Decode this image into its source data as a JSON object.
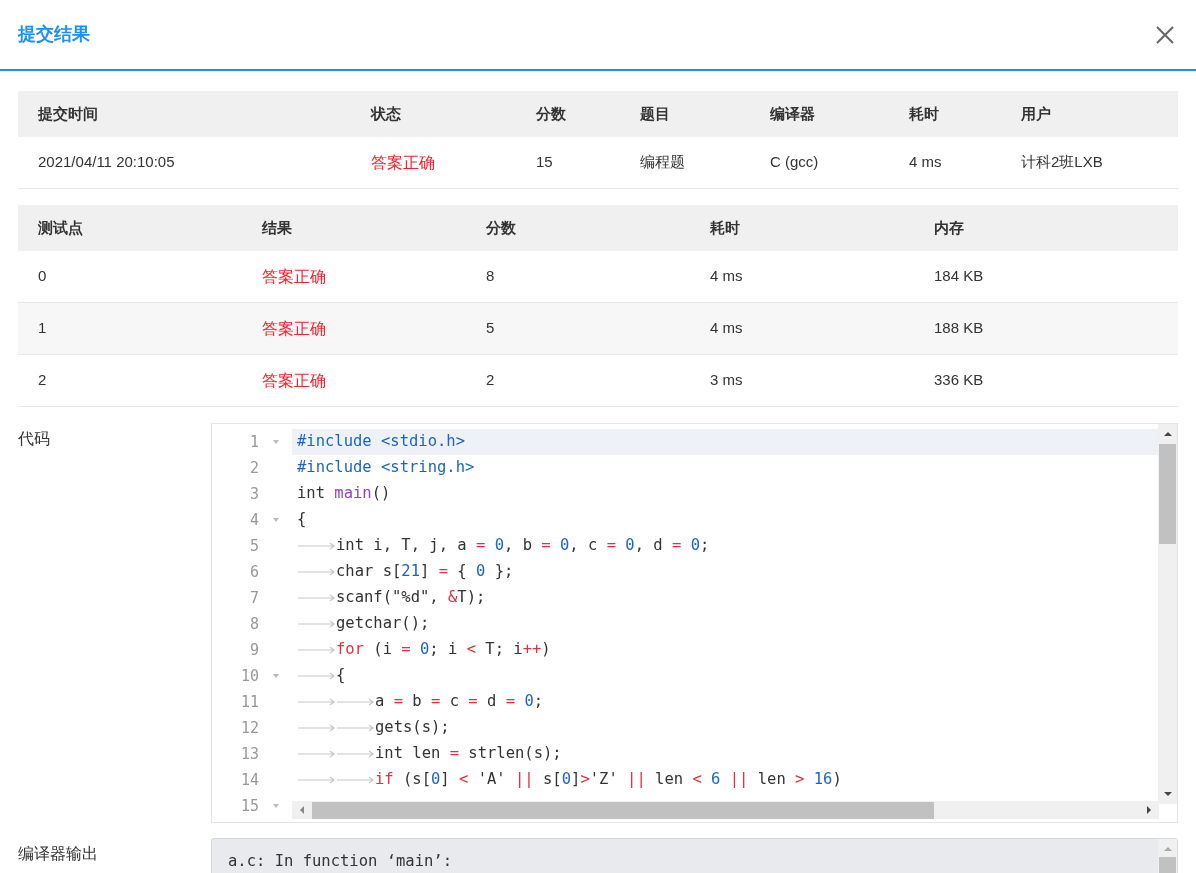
{
  "dialog": {
    "title": "提交结果"
  },
  "submission": {
    "columns": [
      "提交时间",
      "状态",
      "分数",
      "题目",
      "编译器",
      "耗时",
      "用户"
    ],
    "row": [
      "2021/04/11 20:10:05",
      "答案正确",
      "15",
      "编程题",
      "C (gcc)",
      "4 ms",
      "计科2班LXB"
    ]
  },
  "tests": {
    "columns": [
      "测试点",
      "结果",
      "分数",
      "耗时",
      "内存"
    ],
    "rows": [
      [
        "0",
        "答案正确",
        "8",
        "4 ms",
        "184 KB"
      ],
      [
        "1",
        "答案正确",
        "5",
        "4 ms",
        "188 KB"
      ],
      [
        "2",
        "答案正确",
        "2",
        "3 ms",
        "336 KB"
      ]
    ]
  },
  "code": {
    "label": "代码",
    "lines": [
      {
        "number": "1",
        "fold": true,
        "active": true,
        "tokens": [
          {
            "kind": "pre",
            "text": "#include <stdio.h>"
          }
        ]
      },
      {
        "number": "2",
        "fold": false,
        "active": false,
        "tokens": [
          {
            "kind": "pre",
            "text": "#include <string.h>"
          }
        ]
      },
      {
        "number": "3",
        "fold": false,
        "active": false,
        "tokens": [
          {
            "kind": "plain",
            "text": "int "
          },
          {
            "kind": "fn",
            "text": "main"
          },
          {
            "kind": "plain",
            "text": "()"
          }
        ]
      },
      {
        "number": "4",
        "fold": true,
        "active": false,
        "tokens": [
          {
            "kind": "plain",
            "text": "{"
          }
        ]
      },
      {
        "number": "5",
        "fold": false,
        "active": false,
        "tokens": [
          {
            "kind": "tab"
          },
          {
            "kind": "plain",
            "text": "int i, T, j, a"
          },
          {
            "kind": "op",
            "text": " = "
          },
          {
            "kind": "num",
            "text": "0"
          },
          {
            "kind": "plain",
            "text": ", b"
          },
          {
            "kind": "op",
            "text": " = "
          },
          {
            "kind": "num",
            "text": "0"
          },
          {
            "kind": "plain",
            "text": ", c"
          },
          {
            "kind": "op",
            "text": " = "
          },
          {
            "kind": "num",
            "text": "0"
          },
          {
            "kind": "plain",
            "text": ", d"
          },
          {
            "kind": "op",
            "text": " = "
          },
          {
            "kind": "num",
            "text": "0"
          },
          {
            "kind": "plain",
            "text": ";"
          }
        ]
      },
      {
        "number": "6",
        "fold": false,
        "active": false,
        "tokens": [
          {
            "kind": "tab"
          },
          {
            "kind": "plain",
            "text": "char s["
          },
          {
            "kind": "num",
            "text": "21"
          },
          {
            "kind": "plain",
            "text": "] "
          },
          {
            "kind": "op",
            "text": "="
          },
          {
            "kind": "plain",
            "text": " { "
          },
          {
            "kind": "num",
            "text": "0"
          },
          {
            "kind": "plain",
            "text": " };"
          }
        ]
      },
      {
        "number": "7",
        "fold": false,
        "active": false,
        "tokens": [
          {
            "kind": "tab"
          },
          {
            "kind": "plain",
            "text": "scanf(\"%d\", "
          },
          {
            "kind": "op",
            "text": "&"
          },
          {
            "kind": "plain",
            "text": "T);"
          }
        ]
      },
      {
        "number": "8",
        "fold": false,
        "active": false,
        "tokens": [
          {
            "kind": "tab"
          },
          {
            "kind": "plain",
            "text": "getchar();"
          }
        ]
      },
      {
        "number": "9",
        "fold": false,
        "active": false,
        "tokens": [
          {
            "kind": "tab"
          },
          {
            "kind": "kw",
            "text": "for"
          },
          {
            "kind": "plain",
            "text": " (i"
          },
          {
            "kind": "op",
            "text": " = "
          },
          {
            "kind": "num",
            "text": "0"
          },
          {
            "kind": "plain",
            "text": "; i "
          },
          {
            "kind": "op",
            "text": "<"
          },
          {
            "kind": "plain",
            "text": " T; i"
          },
          {
            "kind": "op",
            "text": "++"
          },
          {
            "kind": "plain",
            "text": ")"
          }
        ]
      },
      {
        "number": "10",
        "fold": true,
        "active": false,
        "tokens": [
          {
            "kind": "tab"
          },
          {
            "kind": "plain",
            "text": "{"
          }
        ]
      },
      {
        "number": "11",
        "fold": false,
        "active": false,
        "tokens": [
          {
            "kind": "tab"
          },
          {
            "kind": "tab"
          },
          {
            "kind": "plain",
            "text": "a "
          },
          {
            "kind": "op",
            "text": "="
          },
          {
            "kind": "plain",
            "text": " b "
          },
          {
            "kind": "op",
            "text": "="
          },
          {
            "kind": "plain",
            "text": " c "
          },
          {
            "kind": "op",
            "text": "="
          },
          {
            "kind": "plain",
            "text": " d"
          },
          {
            "kind": "op",
            "text": " = "
          },
          {
            "kind": "num",
            "text": "0"
          },
          {
            "kind": "plain",
            "text": ";"
          }
        ]
      },
      {
        "number": "12",
        "fold": false,
        "active": false,
        "tokens": [
          {
            "kind": "tab"
          },
          {
            "kind": "tab"
          },
          {
            "kind": "plain",
            "text": "gets(s);"
          }
        ]
      },
      {
        "number": "13",
        "fold": false,
        "active": false,
        "tokens": [
          {
            "kind": "tab"
          },
          {
            "kind": "tab"
          },
          {
            "kind": "plain",
            "text": "int len "
          },
          {
            "kind": "op",
            "text": "="
          },
          {
            "kind": "plain",
            "text": " strlen(s);"
          }
        ]
      },
      {
        "number": "14",
        "fold": false,
        "active": false,
        "tokens": [
          {
            "kind": "tab"
          },
          {
            "kind": "tab"
          },
          {
            "kind": "kw",
            "text": "if"
          },
          {
            "kind": "plain",
            "text": " (s["
          },
          {
            "kind": "num",
            "text": "0"
          },
          {
            "kind": "plain",
            "text": "] "
          },
          {
            "kind": "op",
            "text": "<"
          },
          {
            "kind": "plain",
            "text": " 'A' "
          },
          {
            "kind": "op",
            "text": "||"
          },
          {
            "kind": "plain",
            "text": " s["
          },
          {
            "kind": "num",
            "text": "0"
          },
          {
            "kind": "plain",
            "text": "]"
          },
          {
            "kind": "op",
            "text": ">"
          },
          {
            "kind": "plain",
            "text": "'Z' "
          },
          {
            "kind": "op",
            "text": "||"
          },
          {
            "kind": "plain",
            "text": " len"
          },
          {
            "kind": "op",
            "text": " < "
          },
          {
            "kind": "num",
            "text": "6"
          },
          {
            "kind": "op",
            "text": " || "
          },
          {
            "kind": "plain",
            "text": "len"
          },
          {
            "kind": "op",
            "text": " > "
          },
          {
            "kind": "num",
            "text": "16"
          },
          {
            "kind": "plain",
            "text": ")"
          }
        ]
      },
      {
        "number": "15",
        "fold": true,
        "active": false
      }
    ]
  },
  "compiler_output": {
    "label": "编译器输出",
    "text": "a.c: In function ‘main’:"
  }
}
